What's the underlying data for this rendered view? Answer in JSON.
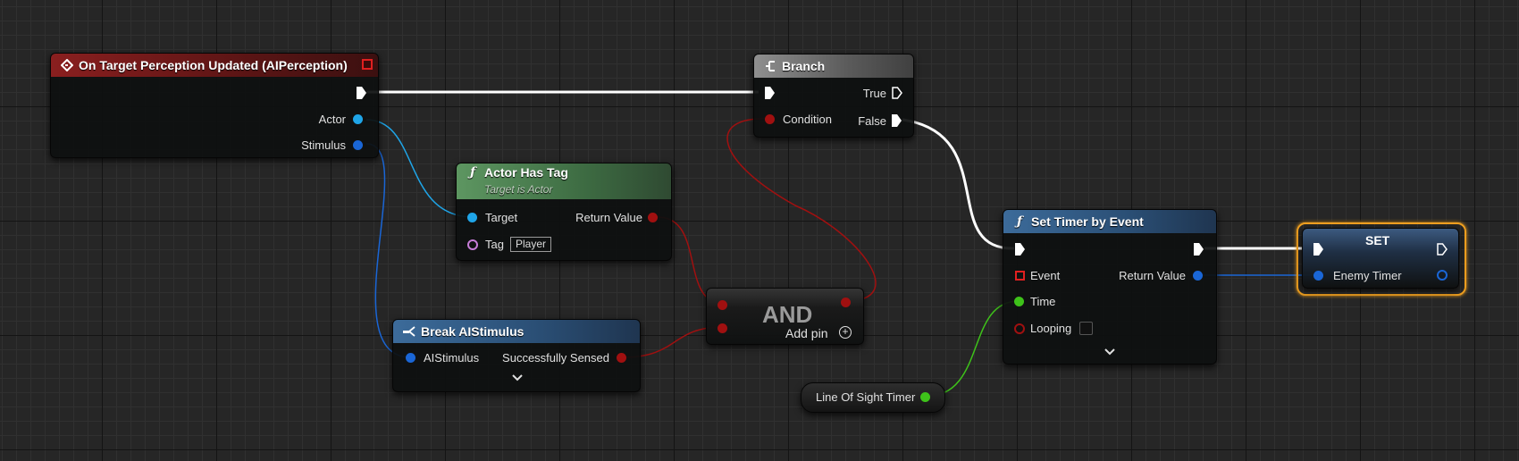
{
  "nodes": {
    "perception": {
      "title": "On Target Perception Updated (AIPerception)",
      "pin_actor": "Actor",
      "pin_stimulus": "Stimulus"
    },
    "branch": {
      "title": "Branch",
      "pin_condition": "Condition",
      "pin_true": "True",
      "pin_false": "False"
    },
    "actor_has_tag": {
      "title": "Actor Has Tag",
      "subtitle": "Target is Actor",
      "pin_target": "Target",
      "pin_tag": "Tag",
      "tag_value": "Player",
      "pin_return": "Return Value"
    },
    "and": {
      "title": "AND",
      "add_pin": "Add pin"
    },
    "break_stimulus": {
      "title": "Break AIStimulus",
      "pin_in": "AIStimulus",
      "pin_sensed": "Successfully Sensed"
    },
    "set_timer": {
      "title": "Set Timer by Event",
      "pin_event": "Event",
      "pin_time": "Time",
      "pin_looping": "Looping",
      "pin_return": "Return Value"
    },
    "line_of_sight": {
      "title": "Line Of Sight Timer"
    },
    "set": {
      "title": "SET",
      "pin_var": "Enemy Timer"
    }
  },
  "colors": {
    "exec": "#ffffff",
    "object": "#1fa5e8",
    "struct": "#1a66d6",
    "bool": "#a01010",
    "float": "#3ec21a",
    "name": "#c77dd8",
    "delegate": "#e02020",
    "selection": "#f0a020"
  },
  "icons": {
    "event": "event-diamond-icon",
    "branch": "branch-icon",
    "function": "function-f-icon",
    "break": "break-struct-icon",
    "expand": "chevron-down-icon",
    "add": "plus-circle-icon",
    "stop": "stop-square-icon"
  }
}
